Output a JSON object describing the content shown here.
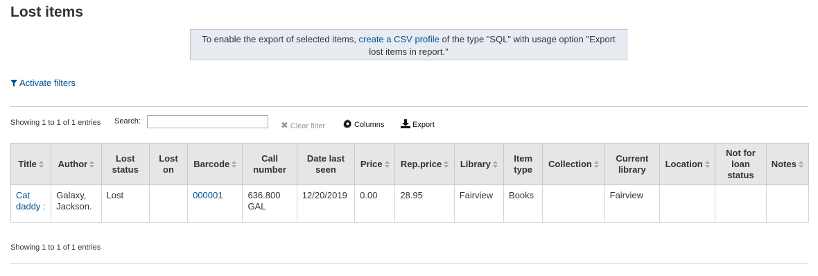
{
  "page": {
    "title": "Lost items"
  },
  "notice": {
    "text_before": "To enable the export of selected items, ",
    "link_text": "create a CSV profile",
    "text_after": " of the type \"SQL\" with usage option \"Export lost items in report.\""
  },
  "filters": {
    "label": "Activate filters"
  },
  "toolbar": {
    "info": "Showing 1 to 1 of 1 entries",
    "search_label": "Search:",
    "search_value": "",
    "clear_filter": "Clear filter",
    "columns": "Columns",
    "export": "Export"
  },
  "table": {
    "headers": [
      "Title",
      "Author",
      "Lost status",
      "Lost on",
      "Barcode",
      "Call number",
      "Date last seen",
      "Price",
      "Rep.price",
      "Library",
      "Item type",
      "Collection",
      "Current library",
      "Location",
      "Not for loan status",
      "Notes"
    ],
    "rows": [
      {
        "title": "Cat daddy :",
        "author": "Galaxy, Jackson.",
        "lost_status": "Lost",
        "lost_on": "",
        "barcode": "000001",
        "call_number": "636.800 GAL",
        "date_last_seen": "12/20/2019",
        "price": "0.00",
        "rep_price": "28.95",
        "library": "Fairview",
        "item_type": "Books",
        "collection": "",
        "current_library": "Fairview",
        "location": "",
        "not_for_loan": "",
        "notes": ""
      }
    ]
  },
  "footer": {
    "info": "Showing 1 to 1 of 1 entries"
  },
  "colors": {
    "link": "#00508c",
    "header_bg": "#e6e6e6",
    "notice_bg": "#e7ecf3"
  }
}
